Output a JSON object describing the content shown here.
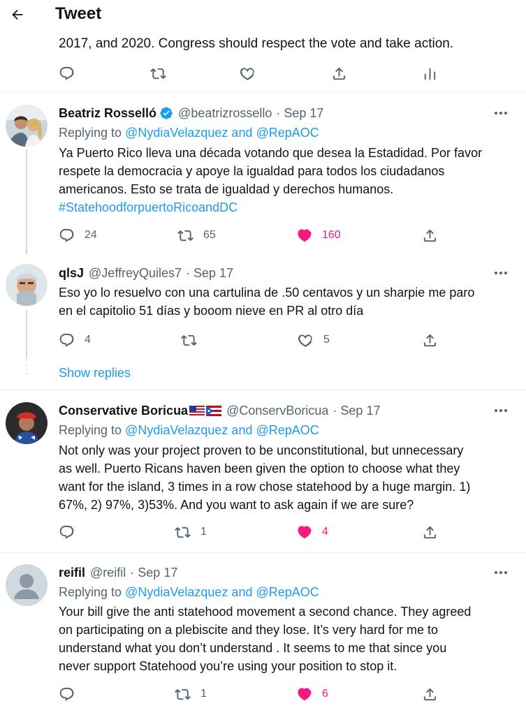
{
  "header": {
    "title": "Tweet"
  },
  "top_tweet": {
    "text": "2017, and 2020. Congress should respect the vote and take action."
  },
  "replies": [
    {
      "name": "Beatriz Rosselló",
      "handle": "@beatrizrossello",
      "date": "· Sep 17",
      "verified": true,
      "replying_prefix": "Replying to",
      "replying_to": "@NydiaVelazquez and @RepAOC",
      "text_lines": [
        "Ya Puerto Rico lleva una década votando que desea la Estadidad. Por favor",
        "respete la democracia y apoye la igualdad para todos los ciudadanos",
        "americanos. Esto se trata de igualdad y derechos humanos."
      ],
      "hashtag": "#StatehoodforpuertoRicoandDC",
      "replies": "24",
      "retweets": "65",
      "likes": "160",
      "liked": true
    },
    {
      "name": "qlsJ",
      "handle": "@JeffreyQuiles7",
      "date": "· Sep 17",
      "text_lines": [
        "Eso yo lo resuelvo con una cartulina de .50 centavos y un sharpie me paro",
        "en el capitolio 51 días y booom nieve en PR al otro día"
      ],
      "replies": "4",
      "retweets": "",
      "likes": "5",
      "liked": false
    },
    {
      "name": "Conservative Boricua",
      "handle": "@ConservBoricua",
      "date": "· Sep 17",
      "replying_prefix": "Replying to",
      "replying_to": "@NydiaVelazquez and @RepAOC",
      "text_lines": [
        "Not only was your project proven to be unconstitutional, but unnecessary",
        "as well. Puerto Ricans haven been given the option to choose what they",
        "want for the island, 3 times in a row chose statehood by a huge margin. 1)",
        "67%, 2) 97%, 3)53%. And you want to ask again if we are sure?"
      ],
      "replies": "",
      "retweets": "1",
      "likes": "4",
      "liked": true
    },
    {
      "name": "reifil",
      "handle": "@reifil",
      "date": "· Sep 17",
      "replying_prefix": "Replying to",
      "replying_to": "@NydiaVelazquez and @RepAOC",
      "text_lines": [
        "Your bill give the anti statehood movement a second chance. They agreed",
        "on participating on a plebiscite and they lose. It’s very hard for me to",
        "understand what you don’t understand . It seems to me that since you",
        "never support Statehood you’re using your position to stop it."
      ],
      "replies": "",
      "retweets": "1",
      "likes": "6",
      "liked": true
    }
  ],
  "show_replies": "Show replies",
  "colors": {
    "accent": "#1d9bf0",
    "like": "#f91880",
    "muted": "#536471"
  },
  "icons": [
    "back-arrow-icon",
    "reply-icon",
    "retweet-icon",
    "like-icon",
    "share-icon",
    "analytics-icon",
    "more-icon",
    "verified-icon"
  ]
}
